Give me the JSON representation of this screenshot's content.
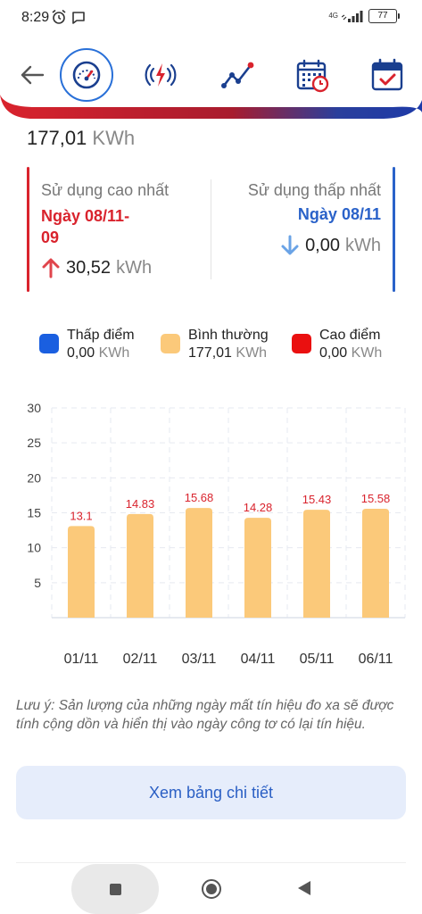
{
  "status_bar": {
    "time": "8:29",
    "network": "4G",
    "battery": "77",
    "alarm_icon": "alarm-clock-icon",
    "message_icon": "chat-bubble-icon"
  },
  "nav": {
    "back_icon": "arrow-left-icon",
    "items": [
      {
        "icon": "speedometer-icon",
        "active": true
      },
      {
        "icon": "power-signal-icon",
        "active": false
      },
      {
        "icon": "line-trend-icon",
        "active": false
      },
      {
        "icon": "calendar-clock-icon",
        "active": false
      },
      {
        "icon": "calendar-check-icon",
        "active": false
      }
    ],
    "colors": {
      "blue": "#2a62c9",
      "red": "#d9232d",
      "dark_red": "#b01c2e"
    }
  },
  "total": {
    "value": "177,01",
    "unit": "KWh"
  },
  "summary": {
    "high": {
      "title": "Sử dụng cao nhất",
      "date_line1": "Ngày 08/11-",
      "date_line2": "09",
      "value": "30,52",
      "unit": "kWh",
      "icon": "arrow-up-icon"
    },
    "low": {
      "title": "Sử dụng thấp nhất",
      "date": "Ngày 08/11",
      "value": "0,00",
      "unit": "kWh",
      "icon": "arrow-down-icon"
    }
  },
  "legend": [
    {
      "label": "Thấp điểm",
      "value": "0,00",
      "unit": "KWh",
      "color": "#1a5fe0"
    },
    {
      "label": "Bình thường",
      "value": "177,01",
      "unit": "KWh",
      "color": "#fbc97a"
    },
    {
      "label": "Cao điểm",
      "value": "0,00",
      "unit": "KWh",
      "color": "#ea1010"
    }
  ],
  "chart_data": {
    "type": "bar",
    "categories": [
      "01/11",
      "02/11",
      "03/11",
      "04/11",
      "05/11",
      "06/11"
    ],
    "values": [
      13.1,
      14.83,
      15.68,
      14.28,
      15.43,
      15.58
    ],
    "value_labels": [
      "13.1",
      "14.83",
      "15.68",
      "14.28",
      "15.43",
      "15.58"
    ],
    "y_ticks": [
      "5",
      "10",
      "15",
      "20",
      "25",
      "30"
    ],
    "ylim": [
      0,
      30
    ],
    "grid": true,
    "bar_color": "#fbc97a",
    "label_color": "#d9232d"
  },
  "note": "Lưu ý: Sản lượng của những ngày mất tín hiệu đo xa sẽ được tính cộng dồn và hiển thị vào ngày công tơ có lại tín hiệu.",
  "detail_button": "Xem bảng chi tiết",
  "system_nav": {
    "recent_icon": "square-icon",
    "home_icon": "circle-icon",
    "back_icon": "triangle-back-icon"
  }
}
